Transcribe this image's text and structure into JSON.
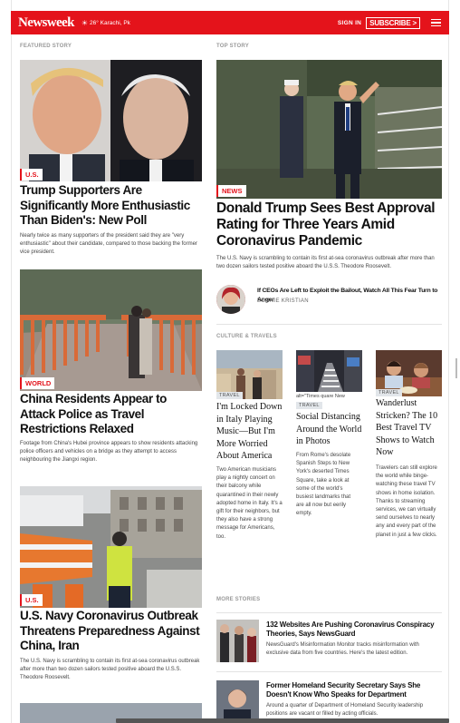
{
  "header": {
    "logo": "Newsweek",
    "weather": "26° Karachi, Pk",
    "sign_in": "SIGN IN",
    "subscribe": "SUBSCRIBE >"
  },
  "featured": {
    "section": "FEATURED STORY",
    "stories": [
      {
        "tag": "U.S.",
        "title": "Trump Supporters Are Significantly More Enthusiastic Than Biden's: New Poll",
        "dek": "Nearly twice as many supporters of the president said they are \"very enthusiastic\" about their candidate, compared to those backing the former vice president."
      },
      {
        "tag": "WORLD",
        "title": "China Residents Appear to Attack Police as Travel Restrictions Relaxed",
        "dek": "Footage from China's Hubei province appears to show residents attacking police officers and vehicles on a bridge as they attempt to access neighbouring the Jiangxi region."
      },
      {
        "tag": "U.S.",
        "title": "U.S. Navy Coronavirus Outbreak Threatens Preparedness Against China, Iran",
        "dek": "The U.S. Navy is scrambling to contain its first at-sea coronavirus outbreak after more than two dozen sailors tested positive aboard the U.S.S. Theodore Roosevelt."
      }
    ]
  },
  "top": {
    "section": "TOP STORY",
    "tag": "NEWS",
    "title": "Donald Trump Sees Best Approval Rating for Three Years Amid Coronavirus Pandemic",
    "dek": "The U.S. Navy is scrambling to contain its first at-sea coronavirus outbreak after more than two dozen sailors tested positive aboard the U.S.S. Theodore Roosevelt.",
    "opinion_title": "If CEOs Are Left to Exploit the Bailout, Watch All This Fear Turn to Anger",
    "opinion_author": "BONNIE KRISTIAN"
  },
  "culture": {
    "section": "CULTURE & TRAVELS",
    "items": [
      {
        "badge": "TRAVEL",
        "title": "I'm Locked Down in Italy Playing Music—But I'm More Worried About America",
        "dek": "Two American musicians play a nightly concert on their balcony while quarantined in their newly adopted home in Italy. It's a gift for their neighbors, but they also have a strong message for Americans, too."
      },
      {
        "alt": "alt=\"Times quare New",
        "badge": "TRAVEL",
        "title": "Social Distancing Around the World in Photos",
        "dek": "From Rome's desolate Spanish Steps to New York's deserted Times Square, take a look at some of the world's busiest landmarks that are all now but eerily empty."
      },
      {
        "badge": "TRAVEL",
        "title": "Wanderlust Stricken? The 10 Best Travel TV Shows to Watch Now",
        "dek": "Travelers can still explore the world while binge-watching these travel TV shows in home isolation. Thanks to streaming services, we can virtually send ourselves to nearly any and every part of the planet in just a few clicks."
      }
    ]
  },
  "more": {
    "section": "MORE STORIES",
    "items": [
      {
        "title": "132 Websites Are Pushing Coronavirus Conspiracy Theories, Says NewsGuard",
        "dek": "NewsGuard's Misinformation Monitor tracks misinformation with exclusive data from five countries. Here's the latest edition."
      },
      {
        "title": "Former Homeland Security Secretary Says She Doesn't Know Who Speaks for Department",
        "dek": "Around a quarter of Department of Homeland Security leadership positions are vacant or filled by acting officials."
      }
    ]
  },
  "colors": {
    "brand": "#e4131b"
  }
}
